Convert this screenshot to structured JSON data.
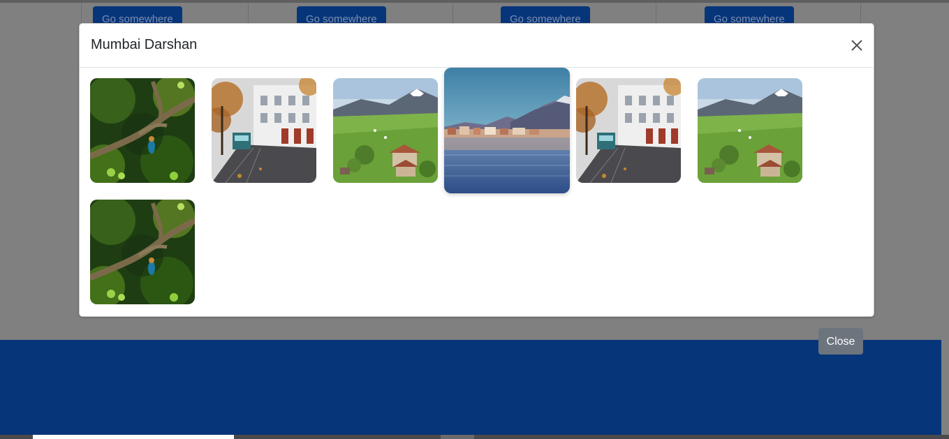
{
  "background": {
    "card_buttons": [
      "Go somewhere",
      "Go somewhere",
      "Go somewhere",
      "Go somewhere"
    ],
    "footer_color": "#06357a"
  },
  "modal": {
    "title": "Mumbai Darshan",
    "close_icon": "close-icon",
    "images": [
      {
        "subject": "kingfisher-on-branch"
      },
      {
        "subject": "city-street-with-tram"
      },
      {
        "subject": "alpine-village-meadow"
      },
      {
        "subject": "lakeside-town-reflection",
        "state": "hover-enlarged"
      },
      {
        "subject": "city-street-with-tram"
      },
      {
        "subject": "alpine-village-meadow"
      },
      {
        "subject": "kingfisher-on-branch"
      }
    ]
  },
  "footer_button": {
    "label": "Close",
    "color": "#6c757d"
  }
}
